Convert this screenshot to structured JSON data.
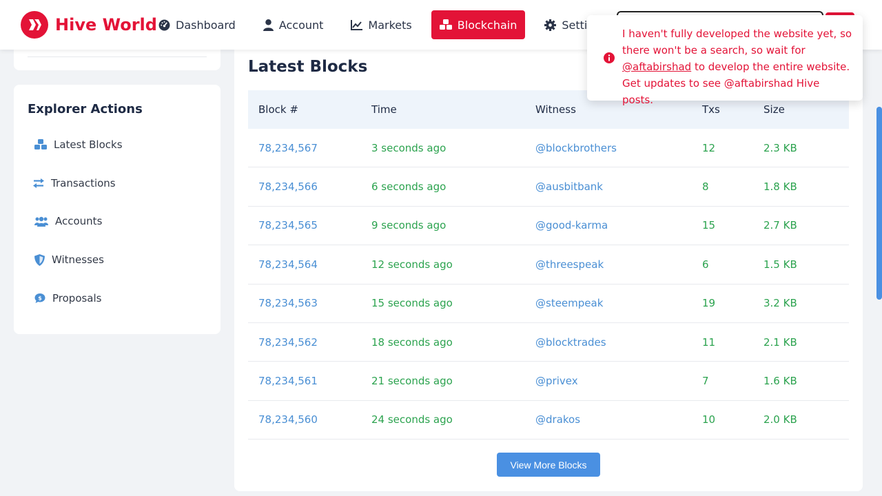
{
  "brand": {
    "name": "Hive World",
    "color": "#e31337",
    "icon": "hive-logo-icon"
  },
  "nav": [
    {
      "label": "Dashboard",
      "icon": "dashboard-icon",
      "active": false
    },
    {
      "label": "Account",
      "icon": "user-icon",
      "active": false
    },
    {
      "label": "Markets",
      "icon": "chart-line-icon",
      "active": false
    },
    {
      "label": "Blockchain",
      "icon": "cubes-icon",
      "active": true
    },
    {
      "label": "Settings",
      "icon": "gear-icon",
      "active": false
    }
  ],
  "sidebar": {
    "title": "Explorer Actions",
    "items": [
      {
        "label": "Latest Blocks",
        "icon": "cubes-icon"
      },
      {
        "label": "Transactions",
        "icon": "exchange-icon"
      },
      {
        "label": "Accounts",
        "icon": "users-icon"
      },
      {
        "label": "Witnesses",
        "icon": "shield-icon"
      },
      {
        "label": "Proposals",
        "icon": "proposal-icon"
      }
    ]
  },
  "main": {
    "title": "Latest Blocks",
    "columns": [
      "Block #",
      "Time",
      "Witness",
      "Txs",
      "Size"
    ],
    "rows": [
      {
        "block": "78,234,567",
        "time": "3 seconds ago",
        "witness": "@blockbrothers",
        "txs": "12",
        "size": "2.3 KB"
      },
      {
        "block": "78,234,566",
        "time": "6 seconds ago",
        "witness": "@ausbitbank",
        "txs": "8",
        "size": "1.8 KB"
      },
      {
        "block": "78,234,565",
        "time": "9 seconds ago",
        "witness": "@good-karma",
        "txs": "15",
        "size": "2.7 KB"
      },
      {
        "block": "78,234,564",
        "time": "12 seconds ago",
        "witness": "@threespeak",
        "txs": "6",
        "size": "1.5 KB"
      },
      {
        "block": "78,234,563",
        "time": "15 seconds ago",
        "witness": "@steempeak",
        "txs": "19",
        "size": "3.2 KB"
      },
      {
        "block": "78,234,562",
        "time": "18 seconds ago",
        "witness": "@blocktrades",
        "txs": "11",
        "size": "2.1 KB"
      },
      {
        "block": "78,234,561",
        "time": "21 seconds ago",
        "witness": "@privex",
        "txs": "7",
        "size": "1.6 KB"
      },
      {
        "block": "78,234,560",
        "time": "24 seconds ago",
        "witness": "@drakos",
        "txs": "10",
        "size": "2.0 KB"
      }
    ],
    "view_more_label": "View More Blocks"
  },
  "toast": {
    "line_before": "I haven't fully developed the website yet, so there won't be a search, so wait for ",
    "mention": "@aftabirshad",
    "line_after": " to develop the entire website. Get updates to see @aftabirshad Hive posts.",
    "icon": "info-circle-icon"
  },
  "colors": {
    "accent": "#e31337",
    "link": "#4a8fd4",
    "green": "#2ca34f",
    "button": "#4a90e2"
  }
}
